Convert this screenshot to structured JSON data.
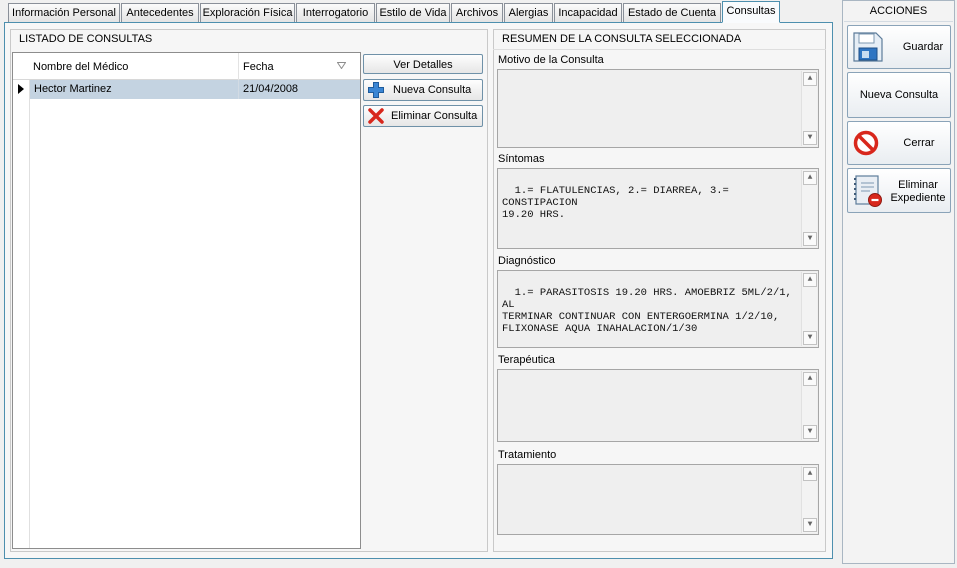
{
  "tabs": [
    {
      "label": "Información Personal"
    },
    {
      "label": "Antecedentes"
    },
    {
      "label": "Exploración Física"
    },
    {
      "label": "Interrogatorio"
    },
    {
      "label": "Estilo de Vida"
    },
    {
      "label": "Archivos"
    },
    {
      "label": "Alergias"
    },
    {
      "label": "Incapacidad"
    },
    {
      "label": "Estado de Cuenta"
    },
    {
      "label": "Consultas",
      "active": true
    }
  ],
  "listado": {
    "title": "LISTADO DE CONSULTAS",
    "columns": [
      "Nombre del Médico",
      "Fecha"
    ],
    "rows": [
      {
        "medico": "Hector Martinez",
        "fecha": "21/04/2008",
        "selected": true
      }
    ],
    "buttons": {
      "ver_detalles": "Ver Detalles",
      "nueva_consulta": "Nueva Consulta",
      "eliminar_consulta": "Eliminar Consulta"
    }
  },
  "resumen": {
    "title": "RESUMEN DE LA CONSULTA SELECCIONADA",
    "fields": [
      {
        "label": "Motivo de la Consulta",
        "value": ""
      },
      {
        "label": "Síntomas",
        "value": "1.= FLATULENCIAS, 2.= DIARREA, 3.= CONSTIPACION\n19.20 HRS."
      },
      {
        "label": "Diagnóstico",
        "value": "1.= PARASITOSIS 19.20 HRS. AMOEBRIZ 5ML/2/1, AL\nTERMINAR CONTINUAR CON ENTERGOERMINA 1/2/10,\nFLIXONASE AQUA INAHALACION/1/30"
      },
      {
        "label": "Terapéutica",
        "value": ""
      },
      {
        "label": "Tratamiento",
        "value": ""
      }
    ]
  },
  "acciones": {
    "title": "ACCIONES",
    "guardar": "Guardar",
    "nueva_consulta": "Nueva Consulta",
    "cerrar": "Cerrar",
    "eliminar_expediente_1": "Eliminar",
    "eliminar_expediente_2": "Expediente"
  },
  "colors": {
    "accent_border": "#4d8fae",
    "selected_row": "#c4d3e1",
    "delete_red": "#d8271c",
    "add_blue": "#3b86d4"
  },
  "icons": {
    "guardar": "floppy-disk-icon",
    "cerrar": "no-entry-icon",
    "eliminar_expediente": "notebook-remove-icon",
    "nueva_consulta": "plus-icon",
    "eliminar_consulta": "red-x-icon",
    "sort": "sort-triangle-icon",
    "current_row": "row-pointer-icon"
  }
}
